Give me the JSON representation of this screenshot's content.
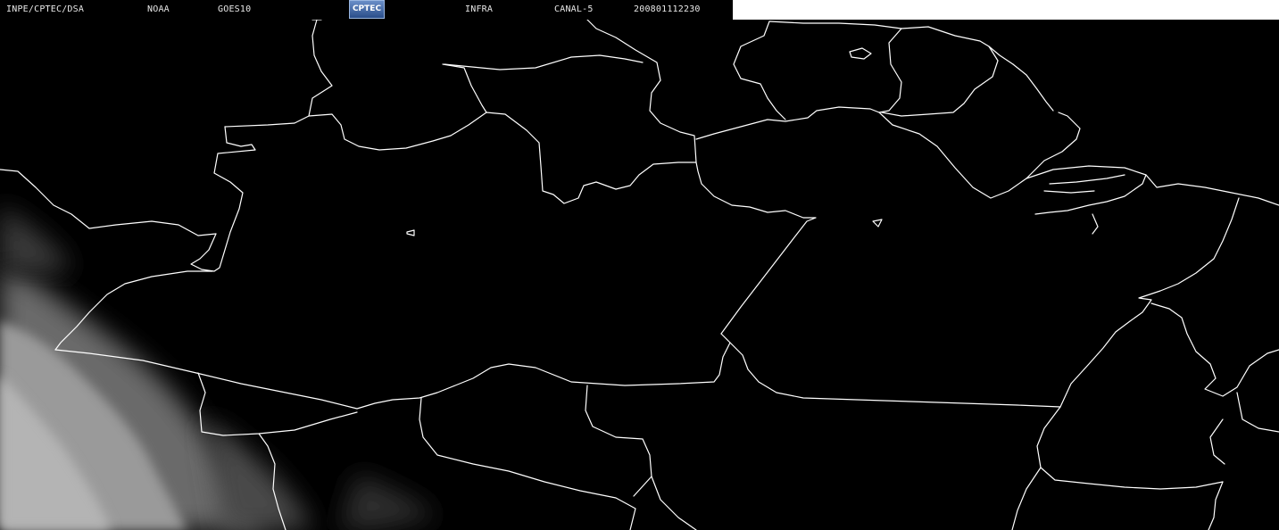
{
  "header": {
    "agency": "INPE/CPTEC/DSA",
    "operator": "NOAA",
    "satellite": "GOES10",
    "logo_text": "CPTEC",
    "image_type": "INFRA",
    "channel": "CANAL-5",
    "datetime": "200801112230"
  },
  "colors": {
    "background": "#000000",
    "borders": "#ffffff",
    "header_text": "#e8e8e8",
    "cloud": "#9a9a9a",
    "header_right_strip": "#ffffff"
  }
}
